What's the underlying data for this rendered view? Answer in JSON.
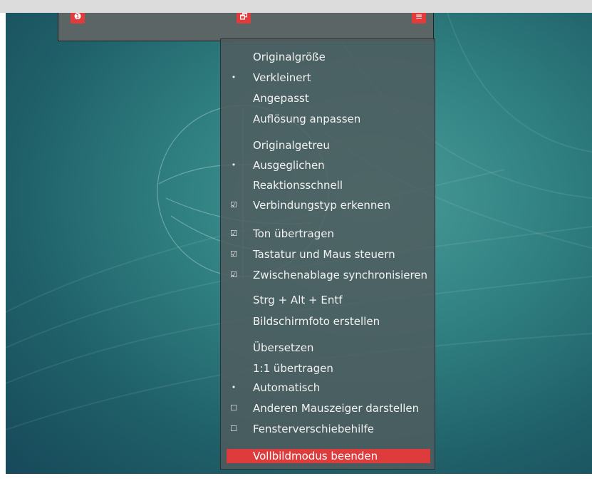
{
  "toolbar": {
    "buttons": [
      {
        "name": "info-button",
        "icon": "info-icon",
        "glyph": "❶"
      },
      {
        "name": "window-button",
        "icon": "windows-icon",
        "glyph": "🗗"
      },
      {
        "name": "menu-button",
        "icon": "hamburger-icon",
        "glyph": "≡"
      }
    ]
  },
  "menu": {
    "items": [
      {
        "label": "Originalgröße",
        "mark": ""
      },
      {
        "label": "Verkleinert",
        "mark": "•"
      },
      {
        "label": "Angepasst",
        "mark": ""
      },
      {
        "label": "Auflösung anpassen",
        "mark": ""
      },
      {
        "label": "Originalgetreu",
        "mark": ""
      },
      {
        "label": "Ausgeglichen",
        "mark": "•"
      },
      {
        "label": "Reaktionsschnell",
        "mark": ""
      },
      {
        "label": "Verbindungstyp erkennen",
        "mark": "☑"
      },
      {
        "label": "Ton übertragen",
        "mark": "☑"
      },
      {
        "label": "Tastatur und Maus steuern",
        "mark": "☑"
      },
      {
        "label": "Zwischenablage synchronisieren",
        "mark": "☑"
      },
      {
        "label": "Strg + Alt + Entf",
        "mark": ""
      },
      {
        "label": "Bildschirmfoto erstellen",
        "mark": ""
      },
      {
        "label": "Übersetzen",
        "mark": ""
      },
      {
        "label": "1:1 übertragen",
        "mark": ""
      },
      {
        "label": "Automatisch",
        "mark": "•"
      },
      {
        "label": "Anderen Mauszeiger darstellen",
        "mark": "☐"
      },
      {
        "label": "Fensterverschiebehilfe",
        "mark": "☐"
      }
    ],
    "exit_label": "Vollbildmodus beenden"
  },
  "colors": {
    "accent": "#e23b3b",
    "menu_background": "#4f5c5e",
    "desktop": "#2f7f80"
  }
}
